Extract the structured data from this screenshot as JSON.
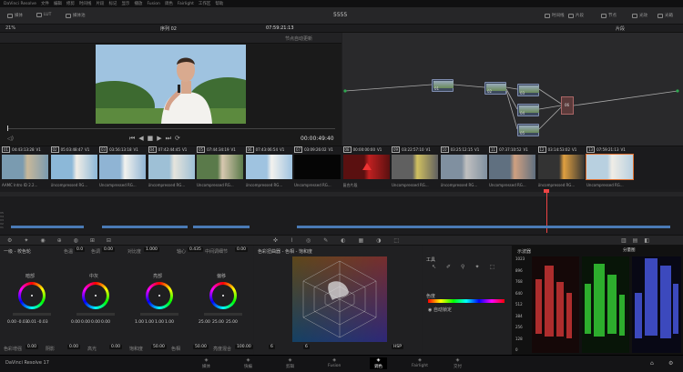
{
  "menubar": {
    "items": [
      "DaVinci Resolve",
      "文件",
      "编辑",
      "修剪",
      "时间线",
      "片段",
      "标记",
      "显示",
      "播放",
      "Fusion",
      "调色",
      "Fairlight",
      "工作区",
      "帮助"
    ]
  },
  "toolbar": {
    "left": [
      "媒体",
      "LUT",
      "媒体池"
    ],
    "project_title": "5555",
    "right": [
      "时间线",
      "片段",
      "节点"
    ],
    "right2": [
      "光效",
      "光箱"
    ]
  },
  "viewer": {
    "zoom": "21%",
    "timeline_name": "序列 02",
    "timecode_top": "07:59:21:13",
    "effect_label": "节点自动更新",
    "timecode_bottom": "00:00:49:40"
  },
  "nodes": {
    "mode": "片段",
    "labels": [
      "01",
      "02",
      "03",
      "04",
      "05",
      "06"
    ]
  },
  "clips": [
    {
      "index": "01",
      "tc": "04:43:13:28",
      "track": "V1",
      "name": "AAMC Intro ID 2.2..."
    },
    {
      "index": "02",
      "tc": "05:03:48:47",
      "track": "V1",
      "name": "Uncompressed RG..."
    },
    {
      "index": "03",
      "tc": "03:56:13:18",
      "track": "V1",
      "name": "Uncompressed RG..."
    },
    {
      "index": "04",
      "tc": "07:42:44:45",
      "track": "V1",
      "name": "Uncompressed RG..."
    },
    {
      "index": "05",
      "tc": "07:44:34:19",
      "track": "V1",
      "name": "Uncompressed RG..."
    },
    {
      "index": "06",
      "tc": "07:43:06:54",
      "track": "V1",
      "name": "Uncompressed RG..."
    },
    {
      "index": "07",
      "tc": "03:09:26:02",
      "track": "V1",
      "name": "Uncompressed RG..."
    },
    {
      "index": "08",
      "tc": "00:00:00:00",
      "track": "V1",
      "name": "复合片段"
    },
    {
      "index": "09",
      "tc": "03:22:57:10",
      "track": "V1",
      "name": "Uncompressed RG..."
    },
    {
      "index": "10",
      "tc": "03:25:12:15",
      "track": "V1",
      "name": "Uncompressed RG..."
    },
    {
      "index": "11",
      "tc": "07:37:10:52",
      "track": "V1",
      "name": "Uncompressed RG..."
    },
    {
      "index": "12",
      "tc": "03:14:53:02",
      "track": "V1",
      "name": "Uncompressed RG..."
    },
    {
      "index": "13",
      "tc": "07:59:21:13",
      "track": "V1",
      "name": "Uncompressed RG..."
    }
  ],
  "color_wheels": {
    "panel_title": "一级 - 校色轮",
    "temp_label": "色温",
    "temp_value": "0.0",
    "tint_label": "色调",
    "tint_value": "0.00",
    "contrast_label": "对比度",
    "contrast_value": "1.000",
    "pivot_label": "轴心",
    "pivot_value": "0.435",
    "mid_detail_label": "中间调细节",
    "mid_detail_value": "0.00",
    "wheels": [
      {
        "name": "暗部",
        "values": [
          "0.00",
          "-0.03",
          "0.01",
          "-0.03"
        ]
      },
      {
        "name": "中灰",
        "values": [
          "0.00",
          "0.00",
          "0.00",
          "0.00"
        ]
      },
      {
        "name": "亮部",
        "values": [
          "1.00",
          "1.00",
          "1.00",
          "1.00"
        ]
      },
      {
        "name": "偏移",
        "values": [
          "25.00",
          "25.00",
          "25.00"
        ]
      }
    ],
    "bottom": [
      {
        "label": "色彩增强",
        "value": "0.00"
      },
      {
        "label": "阴影",
        "value": "0.00"
      },
      {
        "label": "高光",
        "value": "0.00"
      },
      {
        "label": "饱和度",
        "value": "50.00"
      },
      {
        "label": "色相",
        "value": "50.00"
      },
      {
        "label": "亮度混合",
        "value": "100.00"
      }
    ]
  },
  "vectorscope": {
    "title": "色彩扭曲器 - 色相 - 饱和度",
    "dropdown1": "6",
    "dropdown2": "6",
    "mode": "HSP"
  },
  "tools_panel": {
    "title": "工具",
    "section": "色度",
    "auto_label": "自动锁定"
  },
  "scopes": {
    "title": "示波器",
    "mode": "分量图",
    "ticks": [
      "1023",
      "896",
      "768",
      "640",
      "512",
      "384",
      "256",
      "128",
      "0"
    ]
  },
  "status": {
    "app": "DaVinci Resolve 17",
    "pages": [
      "媒体",
      "快编",
      "剪辑",
      "Fusion",
      "调色",
      "Fairlight",
      "交付"
    ],
    "active": "调色"
  }
}
